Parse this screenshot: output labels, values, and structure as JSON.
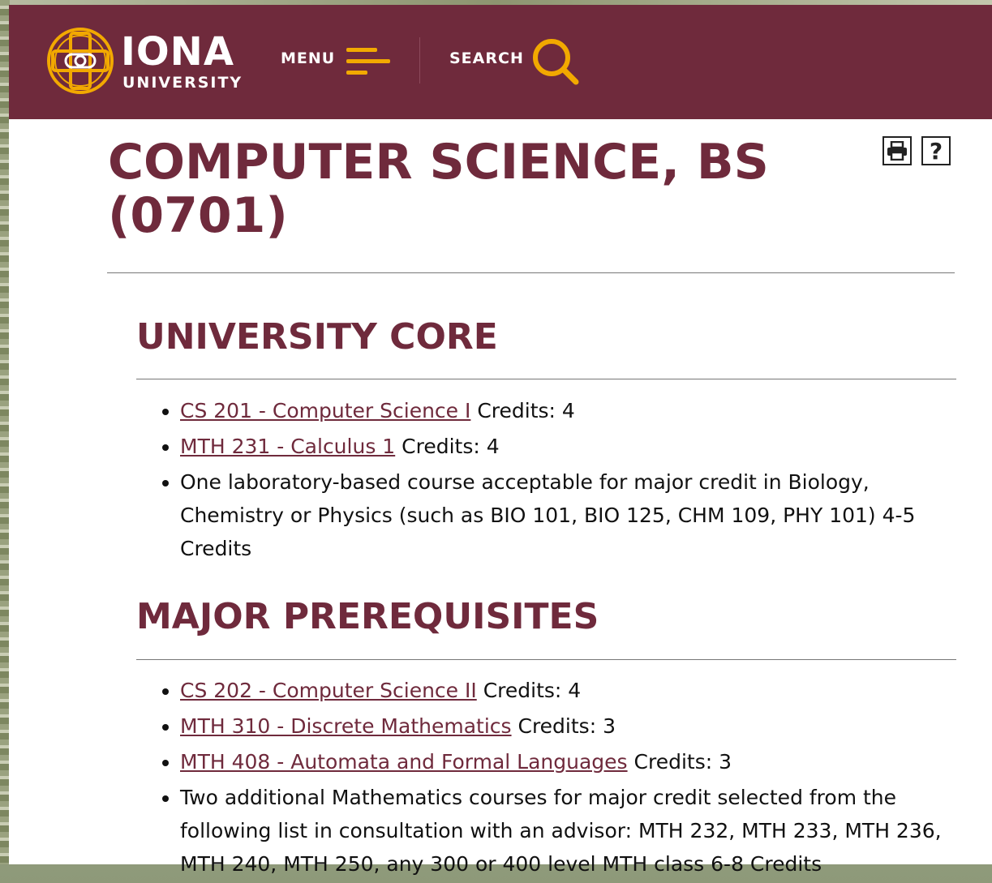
{
  "header": {
    "brand_name": "IONA",
    "brand_sub": "UNIVERSITY",
    "menu_label": "MENU",
    "search_label": "SEARCH",
    "colors": {
      "maroon": "#6f2a3c",
      "gold": "#f2a900"
    }
  },
  "page": {
    "title": "COMPUTER SCIENCE, BS (0701)",
    "print_icon": "printer-icon",
    "help_icon": "question-icon",
    "help_glyph": "?"
  },
  "sections": [
    {
      "title": "UNIVERSITY CORE",
      "items": [
        {
          "link": "CS 201 - Computer Science I",
          "text": " Credits: 4"
        },
        {
          "link": "MTH 231 - Calculus 1",
          "text": " Credits: 4"
        },
        {
          "link": "",
          "text": "One laboratory-based course acceptable for major credit in Biology, Chemistry or Physics (such as BIO 101, BIO 125, CHM 109, PHY 101)  4-5 Credits"
        }
      ]
    },
    {
      "title": "MAJOR PREREQUISITES",
      "items": [
        {
          "link": "CS 202 - Computer Science II",
          "text": " Credits: 4"
        },
        {
          "link": "MTH 310 - Discrete Mathematics",
          "text": " Credits: 3"
        },
        {
          "link": "MTH 408 - Automata and Formal Languages",
          "text": " Credits: 3"
        },
        {
          "link": "",
          "text": "Two additional Mathematics courses for major credit selected from the following list in consultation with an advisor: MTH 232, MTH 233, MTH 236, MTH 240, MTH 250, any 300 or 400 level MTH class  6-8 Credits"
        }
      ]
    }
  ]
}
